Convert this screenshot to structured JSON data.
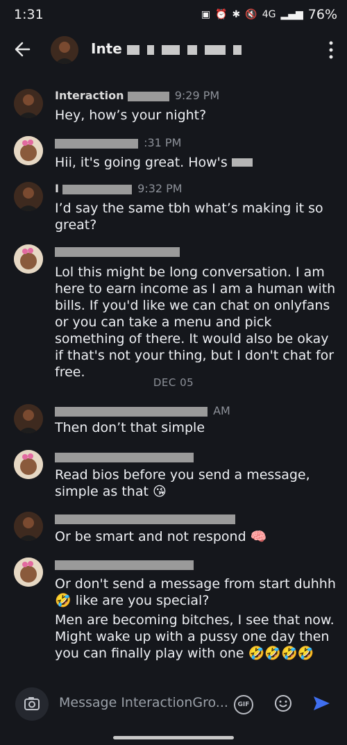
{
  "status": {
    "time": "1:31",
    "network": "4G",
    "battery": "76%",
    "icons": [
      "battery-saver-icon",
      "alarm-icon",
      "bluetooth-icon",
      "mute-icon",
      "signal-icon"
    ]
  },
  "header": {
    "name": "Inte"
  },
  "messages": [
    {
      "sender": "Interaction",
      "time": "9:29 PM",
      "text": "Hey, how’s your night?",
      "avatar": "male"
    },
    {
      "sender": "",
      "time": ":31 PM",
      "text": "Hii, it's going great. How's",
      "avatar": "female"
    },
    {
      "sender": "I",
      "time": "9:32 PM",
      "text": "I’d say the same tbh what’s making it so great?",
      "avatar": "male"
    },
    {
      "sender": "",
      "time": "",
      "text": "Lol this might be long conversation. I am here to earn income as I am a human with bills. If you'd like we can chat on onlyfans or you can take a menu and pick something of there. It would also be okay if that's not your thing, but I don't chat for free.",
      "avatar": "female"
    },
    {
      "sender": "",
      "time": "AM",
      "text": "Then don’t that simple",
      "avatar": "male"
    },
    {
      "sender": "",
      "time": "",
      "text": "Read bios before you send a message, simple as that 😘",
      "avatar": "female"
    },
    {
      "sender": "",
      "time": "",
      "text": "Or be smart and not respond 🧠",
      "avatar": "male"
    },
    {
      "sender": "",
      "time": "",
      "text": "Or don't send a message from start duhhh 🤣 like are you special?",
      "text2": "Men are becoming bitches, I see that now. Might wake up with a pussy one day then you can finally play with one 🤣🤣🤣🤣",
      "avatar": "female"
    }
  ],
  "date_separator": "DEC 05",
  "composer": {
    "placeholder": "Message InteractionGro...",
    "gif_label": "GIF"
  },
  "colors": {
    "background": "#15171c",
    "send": "#3f6ff0"
  }
}
